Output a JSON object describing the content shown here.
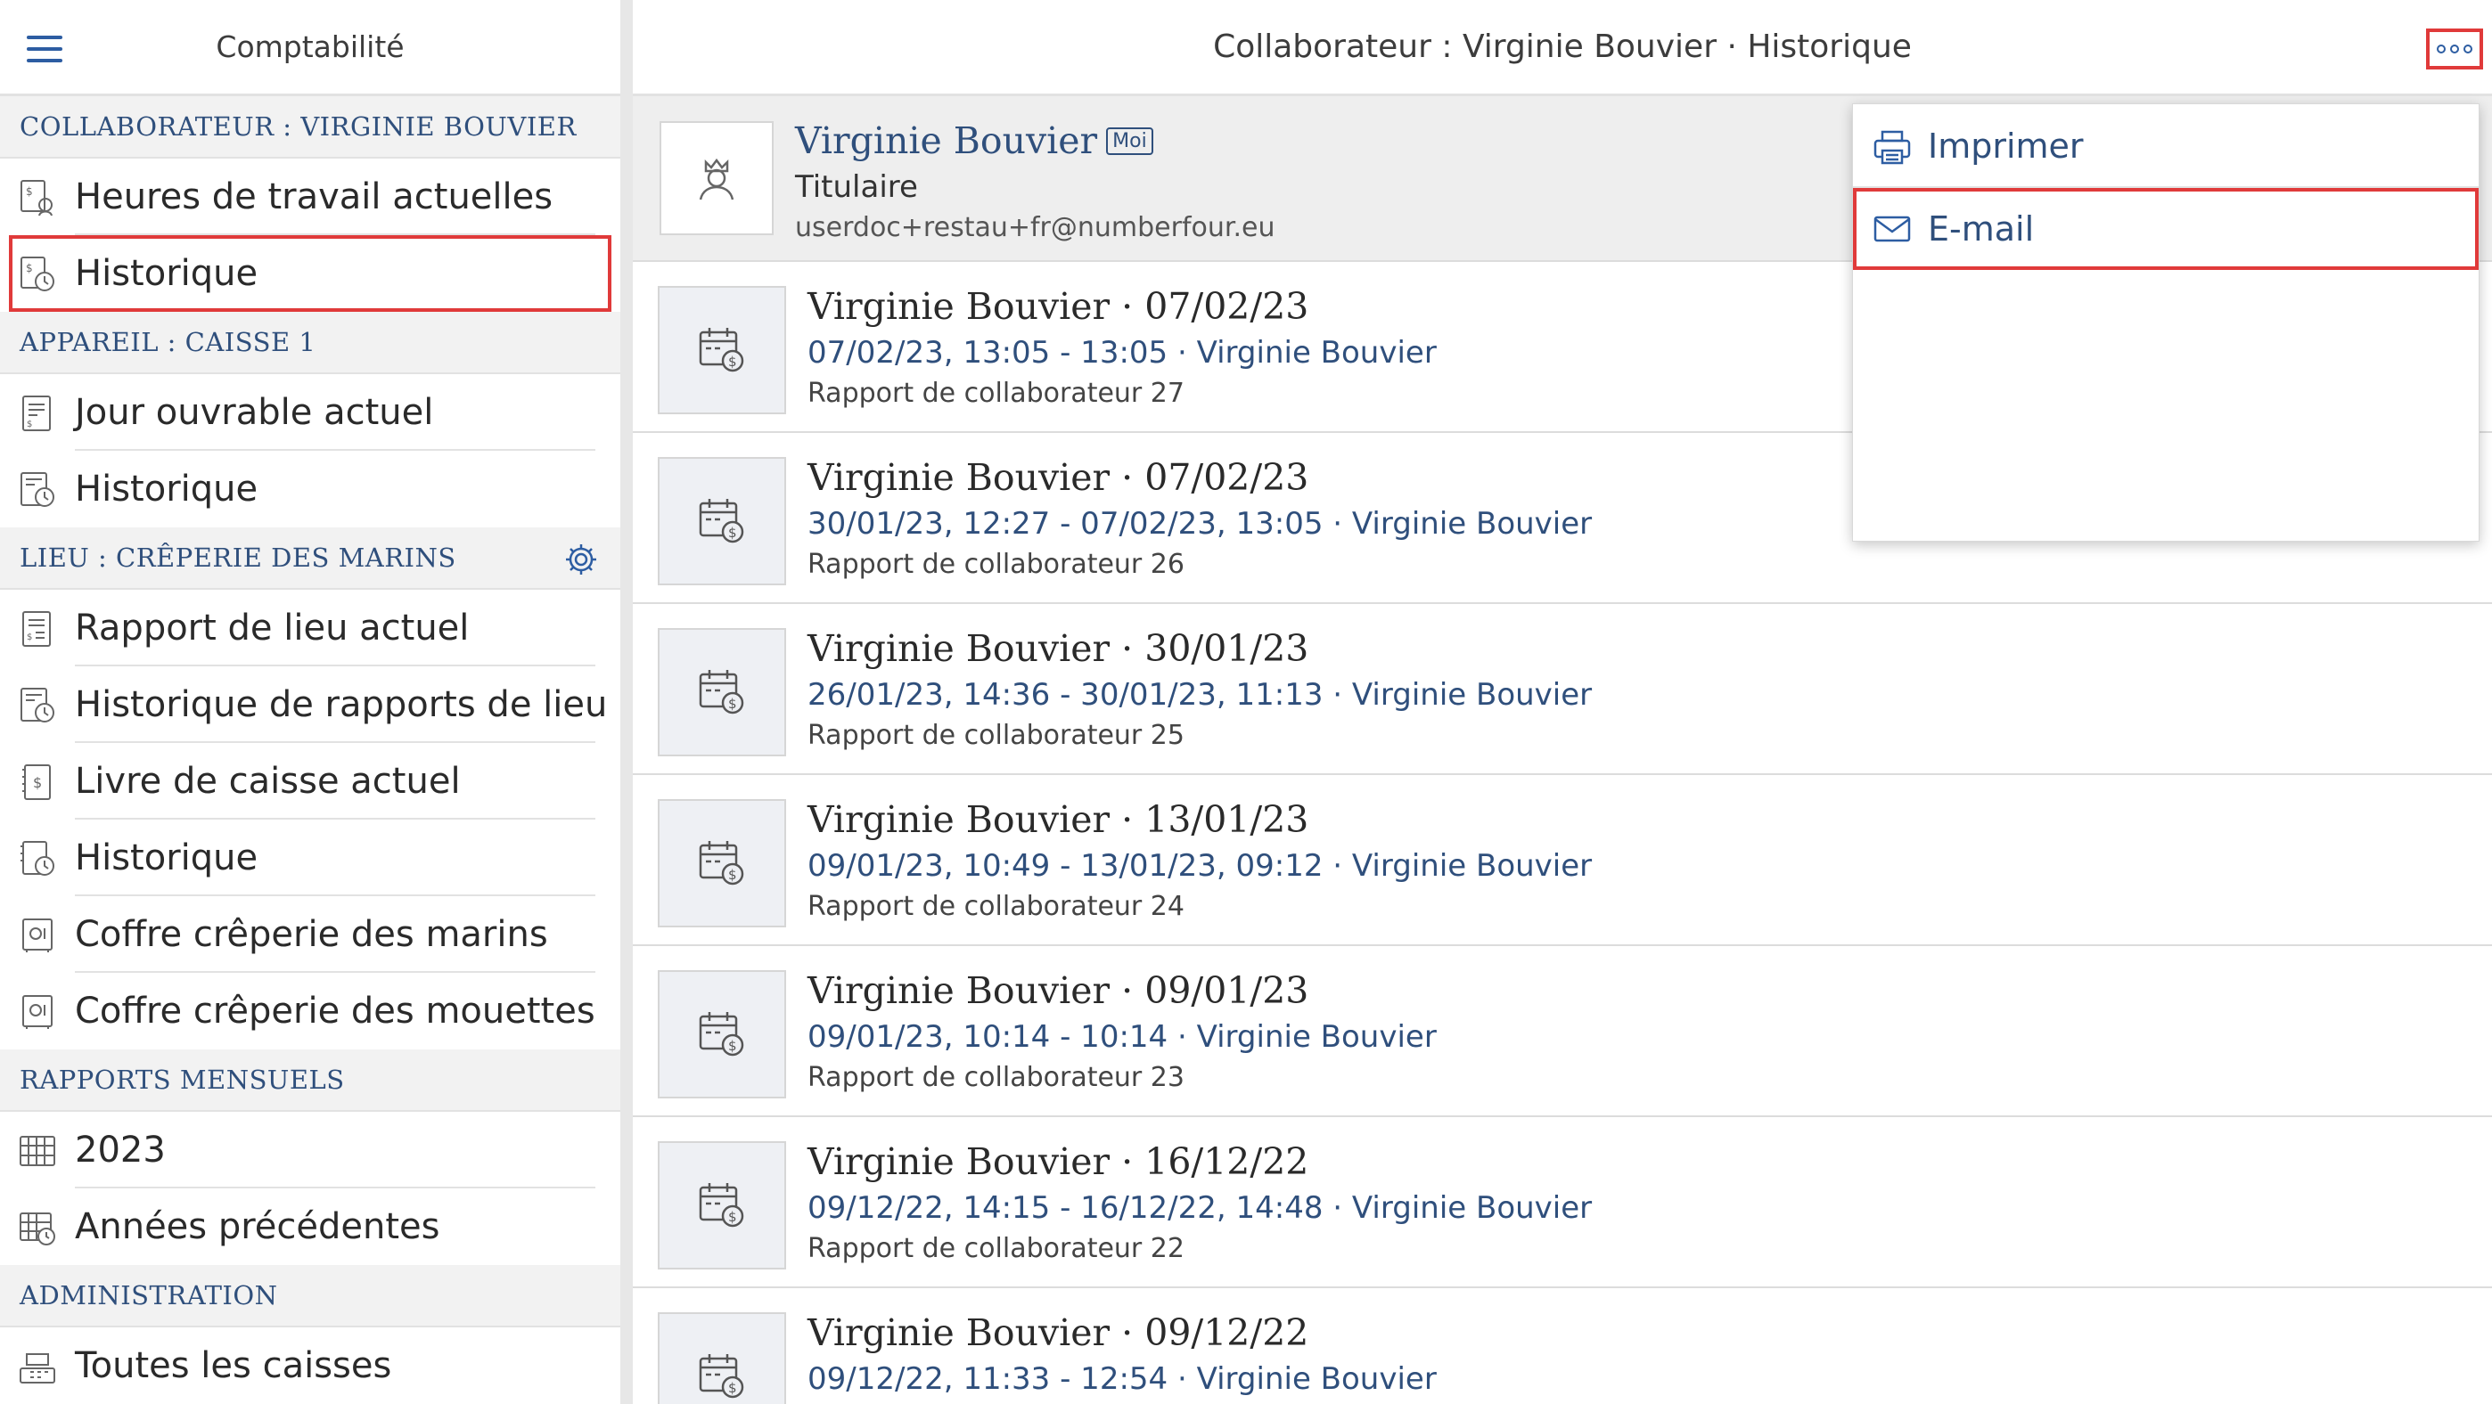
{
  "sidebar": {
    "title": "Comptabilité",
    "sections": [
      {
        "header": "COLLABORATEUR : VIRGINIE BOUVIER",
        "items": [
          {
            "label": "Heures de travail actuelles",
            "icon": "timesheet-icon"
          },
          {
            "label": "Historique",
            "icon": "history-icon",
            "selected": true
          }
        ]
      },
      {
        "header": "APPAREIL : CAISSE 1",
        "items": [
          {
            "label": "Jour ouvrable actuel",
            "icon": "document-icon"
          },
          {
            "label": "Historique",
            "icon": "history-icon"
          }
        ]
      },
      {
        "header": "LIEU : CRÊPERIE DES MARINS",
        "has_settings": true,
        "items": [
          {
            "label": "Rapport de lieu actuel",
            "icon": "report-icon"
          },
          {
            "label": "Historique de rapports de lieu",
            "icon": "history-icon"
          },
          {
            "label": "Livre de caisse actuel",
            "icon": "cashbook-icon"
          },
          {
            "label": "Historique",
            "icon": "history-icon"
          },
          {
            "label": "Coffre crêperie des marins",
            "icon": "safe-icon"
          },
          {
            "label": "Coffre crêperie des mouettes",
            "icon": "safe-icon"
          }
        ]
      },
      {
        "header": "RAPPORTS MENSUELS",
        "items": [
          {
            "label": "2023",
            "icon": "calendar-grid-icon"
          },
          {
            "label": "Années précédentes",
            "icon": "calendar-history-icon"
          }
        ]
      },
      {
        "header": "ADMINISTRATION",
        "items": [
          {
            "label": "Toutes les caisses",
            "icon": "cash-register-icon"
          }
        ]
      }
    ]
  },
  "main": {
    "title": "Collaborateur : Virginie Bouvier · Historique",
    "profile": {
      "name": "Virginie Bouvier",
      "badge": "Moi",
      "role": "Titulaire",
      "email": "userdoc+restau+fr@numberfour.eu"
    },
    "reports": [
      {
        "title": "Virginie Bouvier · 07/02/23",
        "range": "07/02/23, 13:05 - 13:05 · Virginie Bouvier",
        "desc": "Rapport de collaborateur 27"
      },
      {
        "title": "Virginie Bouvier · 07/02/23",
        "range": "30/01/23, 12:27 - 07/02/23, 13:05 · Virginie Bouvier",
        "desc": "Rapport de collaborateur 26"
      },
      {
        "title": "Virginie Bouvier · 30/01/23",
        "range": "26/01/23, 14:36 - 30/01/23, 11:13 · Virginie Bouvier",
        "desc": "Rapport de collaborateur 25"
      },
      {
        "title": "Virginie Bouvier · 13/01/23",
        "range": "09/01/23, 10:49 - 13/01/23, 09:12 · Virginie Bouvier",
        "desc": "Rapport de collaborateur 24"
      },
      {
        "title": "Virginie Bouvier · 09/01/23",
        "range": "09/01/23, 10:14 - 10:14 · Virginie Bouvier",
        "desc": "Rapport de collaborateur 23"
      },
      {
        "title": "Virginie Bouvier · 16/12/22",
        "range": "09/12/22, 14:15 - 16/12/22, 14:48 · Virginie Bouvier",
        "desc": "Rapport de collaborateur 22"
      },
      {
        "title": "Virginie Bouvier · 09/12/22",
        "range": "09/12/22, 11:33 - 12:54 · Virginie Bouvier",
        "desc": ""
      }
    ]
  },
  "dropdown": {
    "items": [
      {
        "label": "Imprimer",
        "icon": "printer-icon"
      },
      {
        "label": "E-mail",
        "icon": "envelope-icon",
        "highlighted": true
      }
    ]
  },
  "colors": {
    "accent": "#2f4f7c",
    "highlight": "#e03a3a",
    "section_bg": "#f2f2f2"
  }
}
